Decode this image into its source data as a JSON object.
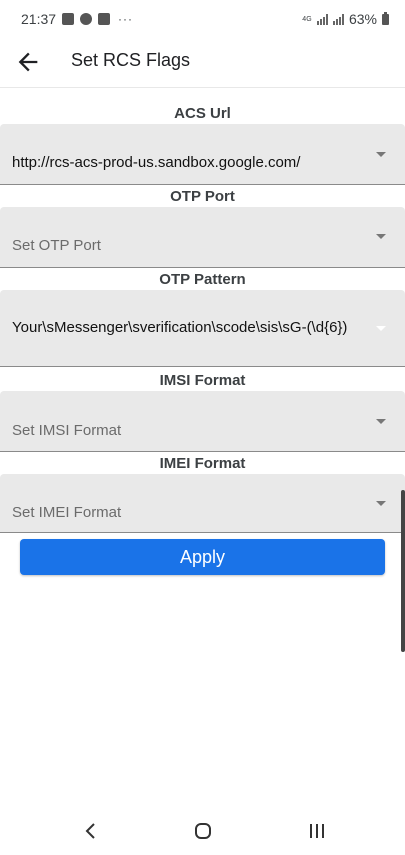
{
  "status_bar": {
    "time": "21:37",
    "more": "···",
    "network": "4G",
    "battery_percent": "63%"
  },
  "app_bar": {
    "title": "Set RCS Flags"
  },
  "form": {
    "fields": [
      {
        "label": "ACS Url",
        "value": "http://rcs-acs-prod-us.sandbox.google.com/",
        "placeholder": ""
      },
      {
        "label": "OTP Port",
        "value": "",
        "placeholder": "Set OTP Port"
      },
      {
        "label": "OTP Pattern",
        "value": "Your\\sMessenger\\sverification\\scode\\sis\\sG-(\\d{6})",
        "placeholder": ""
      },
      {
        "label": "IMSI Format",
        "value": "",
        "placeholder": "Set IMSI Format"
      },
      {
        "label": "IMEI Format",
        "value": "",
        "placeholder": "Set IMEI Format"
      }
    ],
    "apply_label": "Apply"
  },
  "colors": {
    "accent": "#1a73e8",
    "field_bg": "#e9e9e9"
  },
  "icons": [
    "back-arrow-icon",
    "dropdown-caret-icon",
    "nav-back-icon",
    "nav-home-icon",
    "nav-recents-icon"
  ]
}
